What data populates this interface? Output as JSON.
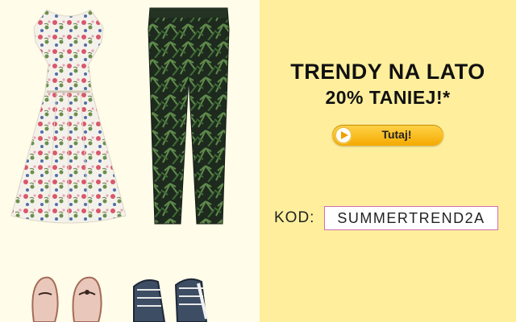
{
  "headline": {
    "line1": "TRENDY NA LATO",
    "line2": "20% TANIEJ!*"
  },
  "cta": {
    "label": "Tutaj!"
  },
  "promo_code": {
    "label": "KOD:",
    "value": "SUMMERTREND2A"
  },
  "colors": {
    "left_bg": "#fffce9",
    "right_bg": "#ffef9d",
    "button": "#f4a900",
    "code_border": "#d26bb0"
  }
}
